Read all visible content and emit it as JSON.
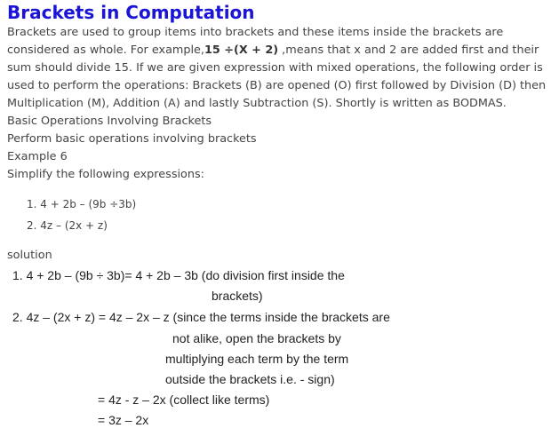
{
  "title": "Brackets in Computation",
  "intro": {
    "text_before": "Brackets are used to group items into brackets and these items inside the brackets are considered as whole. For example,",
    "bold_expression": "15 ÷(X + 2)",
    "text_after": " ,means that x and 2 are added first and their sum should divide 15. If we are given expression with mixed operations, the following order is used to perform the operations: Brackets (B) are opened (O) first followed by Division (D) then Multiplication (M), Addition (A) and lastly Subtraction (S). Shortly is written as BODMAS."
  },
  "subheading1": "Basic Operations Involving Brackets",
  "subheading2": "Perform basic operations involving brackets",
  "example_label": "Example 6",
  "instruction": "Simplify the following expressions:",
  "exercises": [
    "1. 4 + 2b – (9b ÷3b)",
    "2. 4z – (2x + z)"
  ],
  "solution_label": "solution",
  "solution": {
    "s1_main": "1.  4 + 2b – (9b  ÷  3b)= 4 + 2b – 3b  (do division first inside the",
    "s1_cont": "brackets)",
    "s2_main": "2. 4z – (2x + z) = 4z – 2x – z (since the terms inside the brackets are",
    "s2_cont1": "not alike, open the brackets by",
    "s2_cont2": "multiplying each term by the term",
    "s2_cont3": "outside the brackets i.e. - sign)",
    "s2_step2": "= 4z - z – 2x  (collect like terms)",
    "s2_step3": "= 3z – 2x"
  }
}
